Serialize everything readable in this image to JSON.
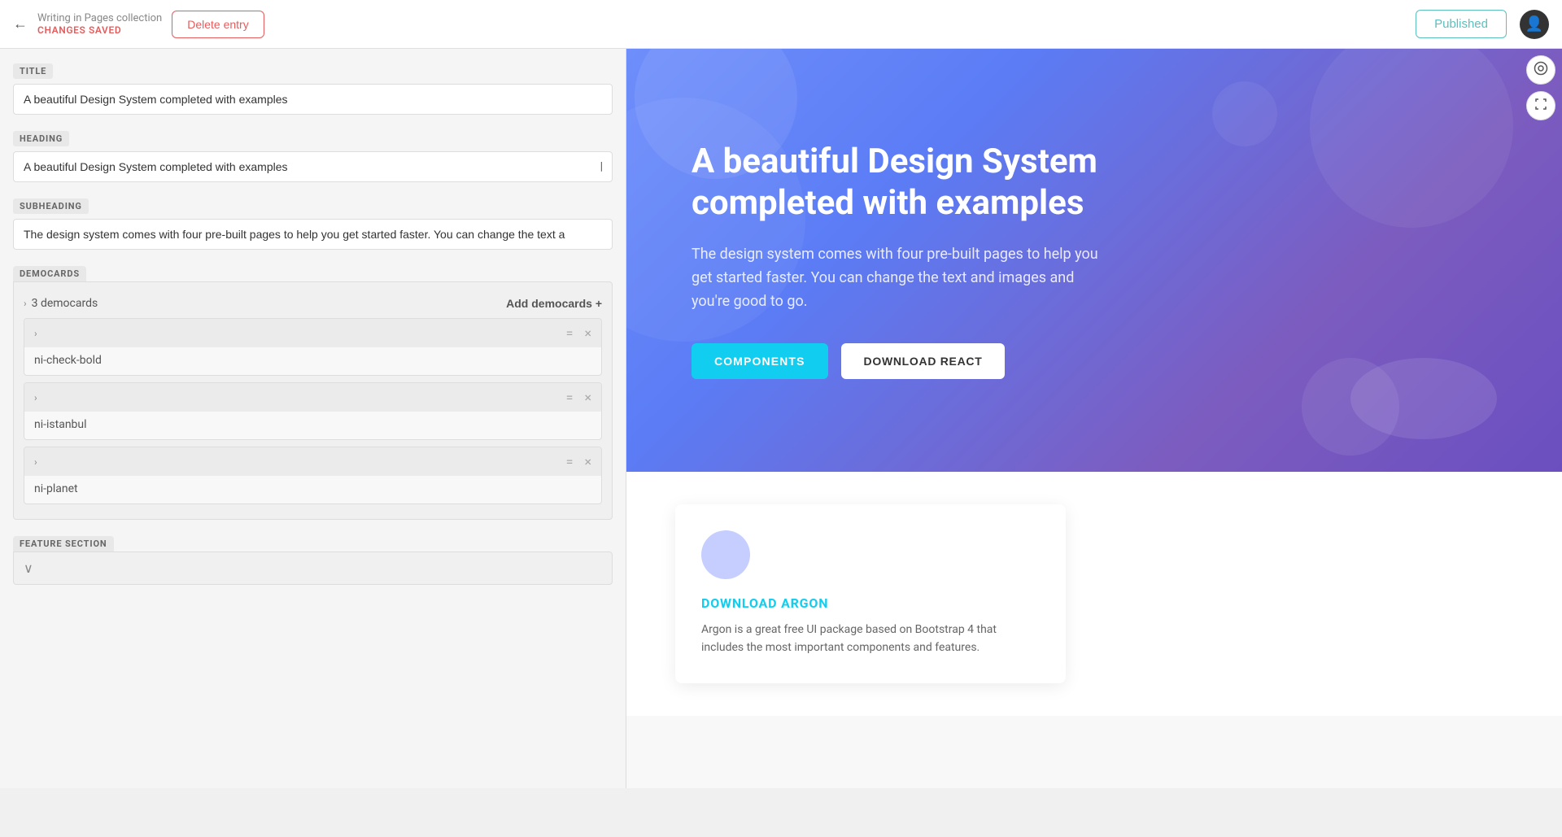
{
  "topbar": {
    "collection_name": "Writing in Pages collection",
    "changes_saved": "CHANGES SAVED",
    "delete_label": "Delete entry",
    "published_label": "Published"
  },
  "left_panel": {
    "title_label": "TITLE",
    "title_value": "A beautiful Design System completed with examples",
    "heading_label": "HEADING",
    "heading_value": "A beautiful Design System completed with examples",
    "subheading_label": "SUBHEADING",
    "subheading_value": "The design system comes with four pre-built pages to help you get started faster. You can change the text a",
    "democards_label": "DEMOCARDS",
    "democards_count": "3 democards",
    "add_democards_label": "Add democards +",
    "democards": [
      {
        "id": 1,
        "name": "ni-check-bold"
      },
      {
        "id": 2,
        "name": "ni-istanbul"
      },
      {
        "id": 3,
        "name": "ni-planet"
      }
    ],
    "feature_section_label": "FEATURE SECTION"
  },
  "preview": {
    "hero_title": "A beautiful Design System completed with examples",
    "hero_subtitle": "The design system comes with four pre-built pages to help you get started faster. You can change the text and images and you're good to go.",
    "btn_components": "COMPONENTS",
    "btn_download": "DOWNLOAD REACT",
    "card_title": "DOWNLOAD ARGON",
    "card_text": "Argon is a great free UI package based on Bootstrap 4 that includes the most important components and features."
  },
  "icons": {
    "back_arrow": "←",
    "eye": "👁",
    "resize": "⤢",
    "chevron_right": "›",
    "drag": "≡",
    "close": "×",
    "chevron_down": "∨",
    "user": "👤",
    "cursor": "|"
  },
  "colors": {
    "components_bg": "#11cdef",
    "hero_gradient_start": "#6e8efb",
    "hero_gradient_end": "#7c5cbf",
    "delete_color": "#e65c5c",
    "published_color": "#5bbfbf",
    "card_title_color": "#11cdef"
  }
}
